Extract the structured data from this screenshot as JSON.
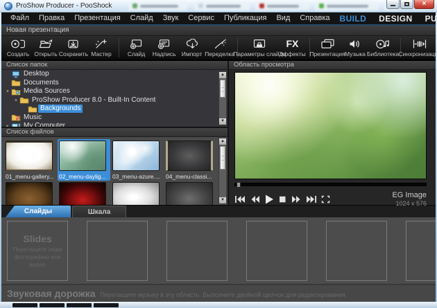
{
  "titlebar": {
    "title": "ProShow Producer - PooShock"
  },
  "menubar": {
    "items": [
      "Файл",
      "Правка",
      "Презентация",
      "Слайд",
      "Звук",
      "Сервис",
      "Публикация",
      "Вид",
      "Справка"
    ],
    "modes": [
      {
        "label": "BUILD",
        "active": true
      },
      {
        "label": "DESIGN",
        "active": false
      },
      {
        "label": "PUBLISH",
        "active": false
      }
    ],
    "accent_color": "#3f8fd4"
  },
  "show_header": {
    "title": "Новая презентация"
  },
  "toolbar": {
    "buttons": [
      {
        "label": "Создать",
        "icon": "new-show-icon",
        "divider_after": false
      },
      {
        "label": "Открыть",
        "icon": "open-folder-icon",
        "divider_after": false
      },
      {
        "label": "Сохранить",
        "icon": "save-icon",
        "divider_after": false
      },
      {
        "label": "Мастер",
        "icon": "wizard-wand-icon",
        "divider_after": true
      },
      {
        "label": "Слайд",
        "icon": "add-slide-icon",
        "divider_after": false
      },
      {
        "label": "Надпись",
        "icon": "add-caption-icon",
        "divider_after": false
      },
      {
        "label": "Импорт",
        "icon": "import-cloud-icon",
        "divider_after": false
      },
      {
        "label": "Переделка",
        "icon": "remix-wand-icon",
        "divider_after": true
      },
      {
        "label": "Параметры слайда",
        "icon": "slide-options-icon",
        "divider_after": false
      },
      {
        "label": "Эффекты",
        "icon": "fx-icon",
        "divider_after": true
      },
      {
        "label": "Презентация",
        "icon": "show-stack-icon",
        "divider_after": false
      },
      {
        "label": "Музыка",
        "icon": "speaker-icon",
        "divider_after": false
      },
      {
        "label": "Библиотека",
        "icon": "library-disc-icon",
        "divider_after": true
      },
      {
        "label": "Синхронизация",
        "icon": "sync-icon",
        "divider_after": false
      }
    ]
  },
  "folders_panel": {
    "title": "Список папок",
    "items": [
      {
        "label": "Desktop",
        "icon": "desktop-icon",
        "depth": 0,
        "expander": "none",
        "selected": false
      },
      {
        "label": "Documents",
        "icon": "folder-icon",
        "depth": 0,
        "expander": "none",
        "selected": false
      },
      {
        "label": "Media Sources",
        "icon": "folder-media-icon",
        "depth": 0,
        "expander": "expanded",
        "selected": false
      },
      {
        "label": "ProShow Producer 8.0 - Built-In Content",
        "icon": "folder-icon",
        "depth": 1,
        "expander": "expanded",
        "selected": false
      },
      {
        "label": "Backgrounds",
        "icon": "folder-icon",
        "depth": 2,
        "expander": "none",
        "selected": true
      },
      {
        "label": "Music",
        "icon": "folder-music-icon",
        "depth": 0,
        "expander": "none",
        "selected": false
      },
      {
        "label": "My Computer",
        "icon": "computer-icon",
        "depth": 0,
        "expander": "collapsed",
        "selected": false
      }
    ]
  },
  "files_panel": {
    "title": "Список файлов",
    "files": [
      {
        "name": "01_menu-gallery...",
        "style": "gallery",
        "selected": false
      },
      {
        "name": "02_menu-daylig...",
        "style": "daylight",
        "selected": true
      },
      {
        "name": "03_menu-azure....",
        "style": "azure",
        "selected": false
      },
      {
        "name": "04_menu-classi...",
        "style": "classic",
        "selected": false
      },
      {
        "name": "",
        "style": "rust",
        "selected": false
      },
      {
        "name": "",
        "style": "curtain",
        "selected": false
      },
      {
        "name": "",
        "style": "silver",
        "selected": false
      },
      {
        "name": "",
        "style": "charcoal",
        "selected": false
      }
    ]
  },
  "preview_panel": {
    "title": "Область просмотра",
    "media_type": "EG Image",
    "resolution": "1024 x 576",
    "transport": [
      "skip-start",
      "rewind",
      "play",
      "stop",
      "fast-forward",
      "skip-end",
      "fullscreen"
    ]
  },
  "tabs": [
    {
      "label": "Слайды",
      "active": true
    },
    {
      "label": "Шкала",
      "active": false
    }
  ],
  "slides_strip": {
    "title": "Slides",
    "hint_line1": "Перетащите сюда",
    "hint_line2": "фотографию или видео",
    "placeholder_count": 6
  },
  "soundtrack": {
    "title": "Звуковая дорожка",
    "hint": "Перетащите музыку в эту область. Выполните двойной щелчок для редактирования."
  }
}
